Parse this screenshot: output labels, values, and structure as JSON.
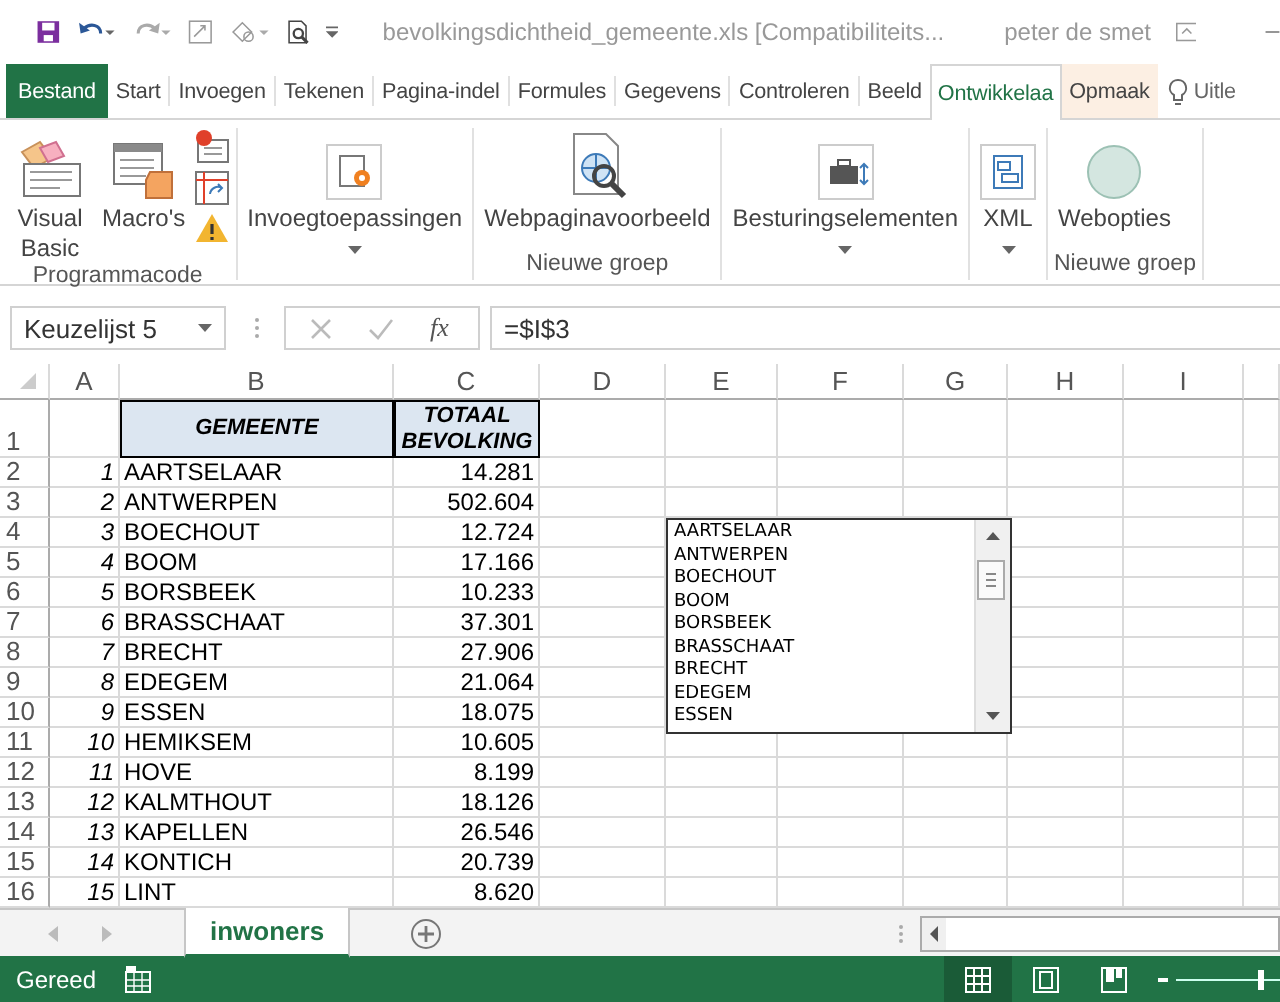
{
  "title_bar": {
    "title": "bevolkingsdichtheid_gemeente.xls  [Compatibiliteits...",
    "user": "peter de smet"
  },
  "ribbon_tabs": [
    {
      "label": "Bestand",
      "kind": "file",
      "selected": false
    },
    {
      "label": "Start",
      "kind": "tab",
      "selected": false
    },
    {
      "label": "Invoegen",
      "kind": "tab",
      "selected": false
    },
    {
      "label": "Tekenen",
      "kind": "tab",
      "selected": false
    },
    {
      "label": "Pagina-indel",
      "kind": "tab",
      "selected": false
    },
    {
      "label": "Formules",
      "kind": "tab",
      "selected": false
    },
    {
      "label": "Gegevens",
      "kind": "tab",
      "selected": false
    },
    {
      "label": "Controleren",
      "kind": "tab",
      "selected": false
    },
    {
      "label": "Beeld",
      "kind": "tab",
      "selected": false
    },
    {
      "label": "Ontwikkelaa",
      "kind": "tab",
      "selected": true
    },
    {
      "label": "Opmaak",
      "kind": "contextual",
      "selected": false
    }
  ],
  "tell_me": "Uitle",
  "ribbon_groups": [
    {
      "label": "Programmacode",
      "buttons": [
        {
          "kind": "vb",
          "label": "Visual Basic",
          "dropdown": false
        },
        {
          "kind": "macros",
          "label": "Macro's",
          "dropdown": false
        },
        {
          "kind": "small-stack"
        }
      ]
    },
    {
      "buttons": [
        {
          "kind": "addins",
          "label": "Invoegtoepassingen",
          "dropdown": true
        }
      ]
    },
    {
      "label": "Nieuwe groep",
      "buttons": [
        {
          "kind": "webpreview",
          "label": "Webpaginavoorbeeld",
          "dropdown": false
        }
      ]
    },
    {
      "buttons": [
        {
          "kind": "controls",
          "label": "Besturingselementen",
          "dropdown": true
        }
      ]
    },
    {
      "buttons": [
        {
          "kind": "xml",
          "label": "XML",
          "dropdown": true
        }
      ]
    },
    {
      "label": "Nieuwe groep",
      "buttons": [
        {
          "kind": "circle",
          "label": "Webopties",
          "dropdown": false
        }
      ]
    }
  ],
  "formula_bar": {
    "name_box": "Keuzelijst 5",
    "function_symbol": "fx",
    "formula": "=$I$3"
  },
  "sheet": {
    "columns": [
      "A",
      "B",
      "C",
      "D",
      "E",
      "F",
      "G",
      "H",
      "I"
    ],
    "header_row": {
      "row": "1",
      "cells": [
        "GEMEENTE",
        "TOTAAL BEVOLKING"
      ]
    },
    "rows": [
      {
        "row": "2",
        "index": "1",
        "name": "AARTSELAAR",
        "population": "14.281"
      },
      {
        "row": "3",
        "index": "2",
        "name": "ANTWERPEN",
        "population": "502.604"
      },
      {
        "row": "4",
        "index": "3",
        "name": "BOECHOUT",
        "population": "12.724"
      },
      {
        "row": "5",
        "index": "4",
        "name": "BOOM",
        "population": "17.166"
      },
      {
        "row": "6",
        "index": "5",
        "name": "BORSBEEK",
        "population": "10.233"
      },
      {
        "row": "7",
        "index": "6",
        "name": "BRASSCHAAT",
        "population": "37.301"
      },
      {
        "row": "8",
        "index": "7",
        "name": "BRECHT",
        "population": "27.906"
      },
      {
        "row": "9",
        "index": "8",
        "name": "EDEGEM",
        "population": "21.064"
      },
      {
        "row": "10",
        "index": "9",
        "name": "ESSEN",
        "population": "18.075"
      },
      {
        "row": "11",
        "index": "10",
        "name": "HEMIKSEM",
        "population": "10.605"
      },
      {
        "row": "12",
        "index": "11",
        "name": "HOVE",
        "population": "8.199"
      },
      {
        "row": "13",
        "index": "12",
        "name": "KALMTHOUT",
        "population": "18.126"
      },
      {
        "row": "14",
        "index": "13",
        "name": "KAPELLEN",
        "population": "26.546"
      },
      {
        "row": "15",
        "index": "14",
        "name": "KONTICH",
        "population": "20.739"
      },
      {
        "row": "16",
        "index": "15",
        "name": "LINT",
        "population": "8.620"
      }
    ],
    "listbox": {
      "items": [
        "AARTSELAAR",
        "ANTWERPEN",
        "BOECHOUT",
        "BOOM",
        "BORSBEEK",
        "BRASSCHAAT",
        "BRECHT",
        "EDEGEM",
        "ESSEN"
      ]
    }
  },
  "sheet_tabs": [
    {
      "label": "inwoners",
      "selected": true
    }
  ],
  "status_bar": {
    "status": "Gereed",
    "views": [
      {
        "kind": "normal",
        "selected": true
      },
      {
        "kind": "page-layout",
        "selected": false
      },
      {
        "kind": "page-break",
        "selected": false
      }
    ]
  }
}
